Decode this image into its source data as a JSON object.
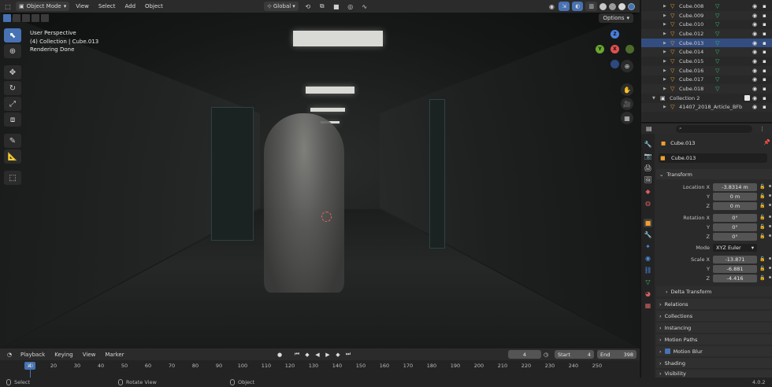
{
  "header": {
    "mode": "Object Mode",
    "menus": [
      "View",
      "Select",
      "Add",
      "Object"
    ],
    "transform_orientation": "Global"
  },
  "viewport": {
    "options_label": "Options",
    "overlay_lines": [
      "User Perspective",
      "(4) Collection | Cube.013",
      "Rendering Done"
    ],
    "gizmo_axes": {
      "x": "X",
      "y": "Y",
      "z": "Z"
    }
  },
  "outliner": {
    "items": [
      {
        "name": "Cube.008",
        "selected": false
      },
      {
        "name": "Cube.009",
        "selected": false
      },
      {
        "name": "Cube.010",
        "selected": false
      },
      {
        "name": "Cube.012",
        "selected": false
      },
      {
        "name": "Cube.013",
        "selected": true
      },
      {
        "name": "Cube.014",
        "selected": false
      },
      {
        "name": "Cube.015",
        "selected": false
      },
      {
        "name": "Cube.016",
        "selected": false
      },
      {
        "name": "Cube.017",
        "selected": false
      },
      {
        "name": "Cube.018",
        "selected": false
      }
    ],
    "collection2": "Collection 2",
    "collection2_child": "41407_2018_Article_BFb"
  },
  "properties": {
    "object_name": "Cube.013",
    "object_field": "Cube.013",
    "transform_label": "Transform",
    "location_label": "Location X",
    "location": [
      "-3.8314 m",
      "0 m",
      "0 m"
    ],
    "rotation_label": "Rotation X",
    "rotation": [
      "0°",
      "0°",
      "0°"
    ],
    "mode_label": "Mode",
    "mode_value": "XYZ Euler",
    "scale_label": "Scale X",
    "scale": [
      "-13.871",
      "-6.881",
      "-4.416"
    ],
    "axis_y": "Y",
    "axis_z": "Z",
    "delta_transform": "Delta Transform",
    "panels": [
      "Relations",
      "Collections",
      "Instancing",
      "Motion Paths",
      "Motion Blur",
      "Shading",
      "Visibility"
    ]
  },
  "timeline": {
    "menus": [
      "Playback",
      "Keying",
      "View",
      "Marker"
    ],
    "current_frame": "4",
    "start_label": "Start",
    "start_value": "4",
    "end_label": "End",
    "end_value": "398",
    "ticks": [
      "10",
      "20",
      "30",
      "40",
      "50",
      "60",
      "70",
      "80",
      "90",
      "100",
      "110",
      "120",
      "130",
      "140",
      "150",
      "160",
      "170",
      "180",
      "190",
      "200",
      "210",
      "220",
      "230",
      "240",
      "250"
    ],
    "cursor_frame": "4"
  },
  "statusbar": {
    "select": "Select",
    "rotate": "Rotate View",
    "object": "Object",
    "version": "4.0.2"
  }
}
